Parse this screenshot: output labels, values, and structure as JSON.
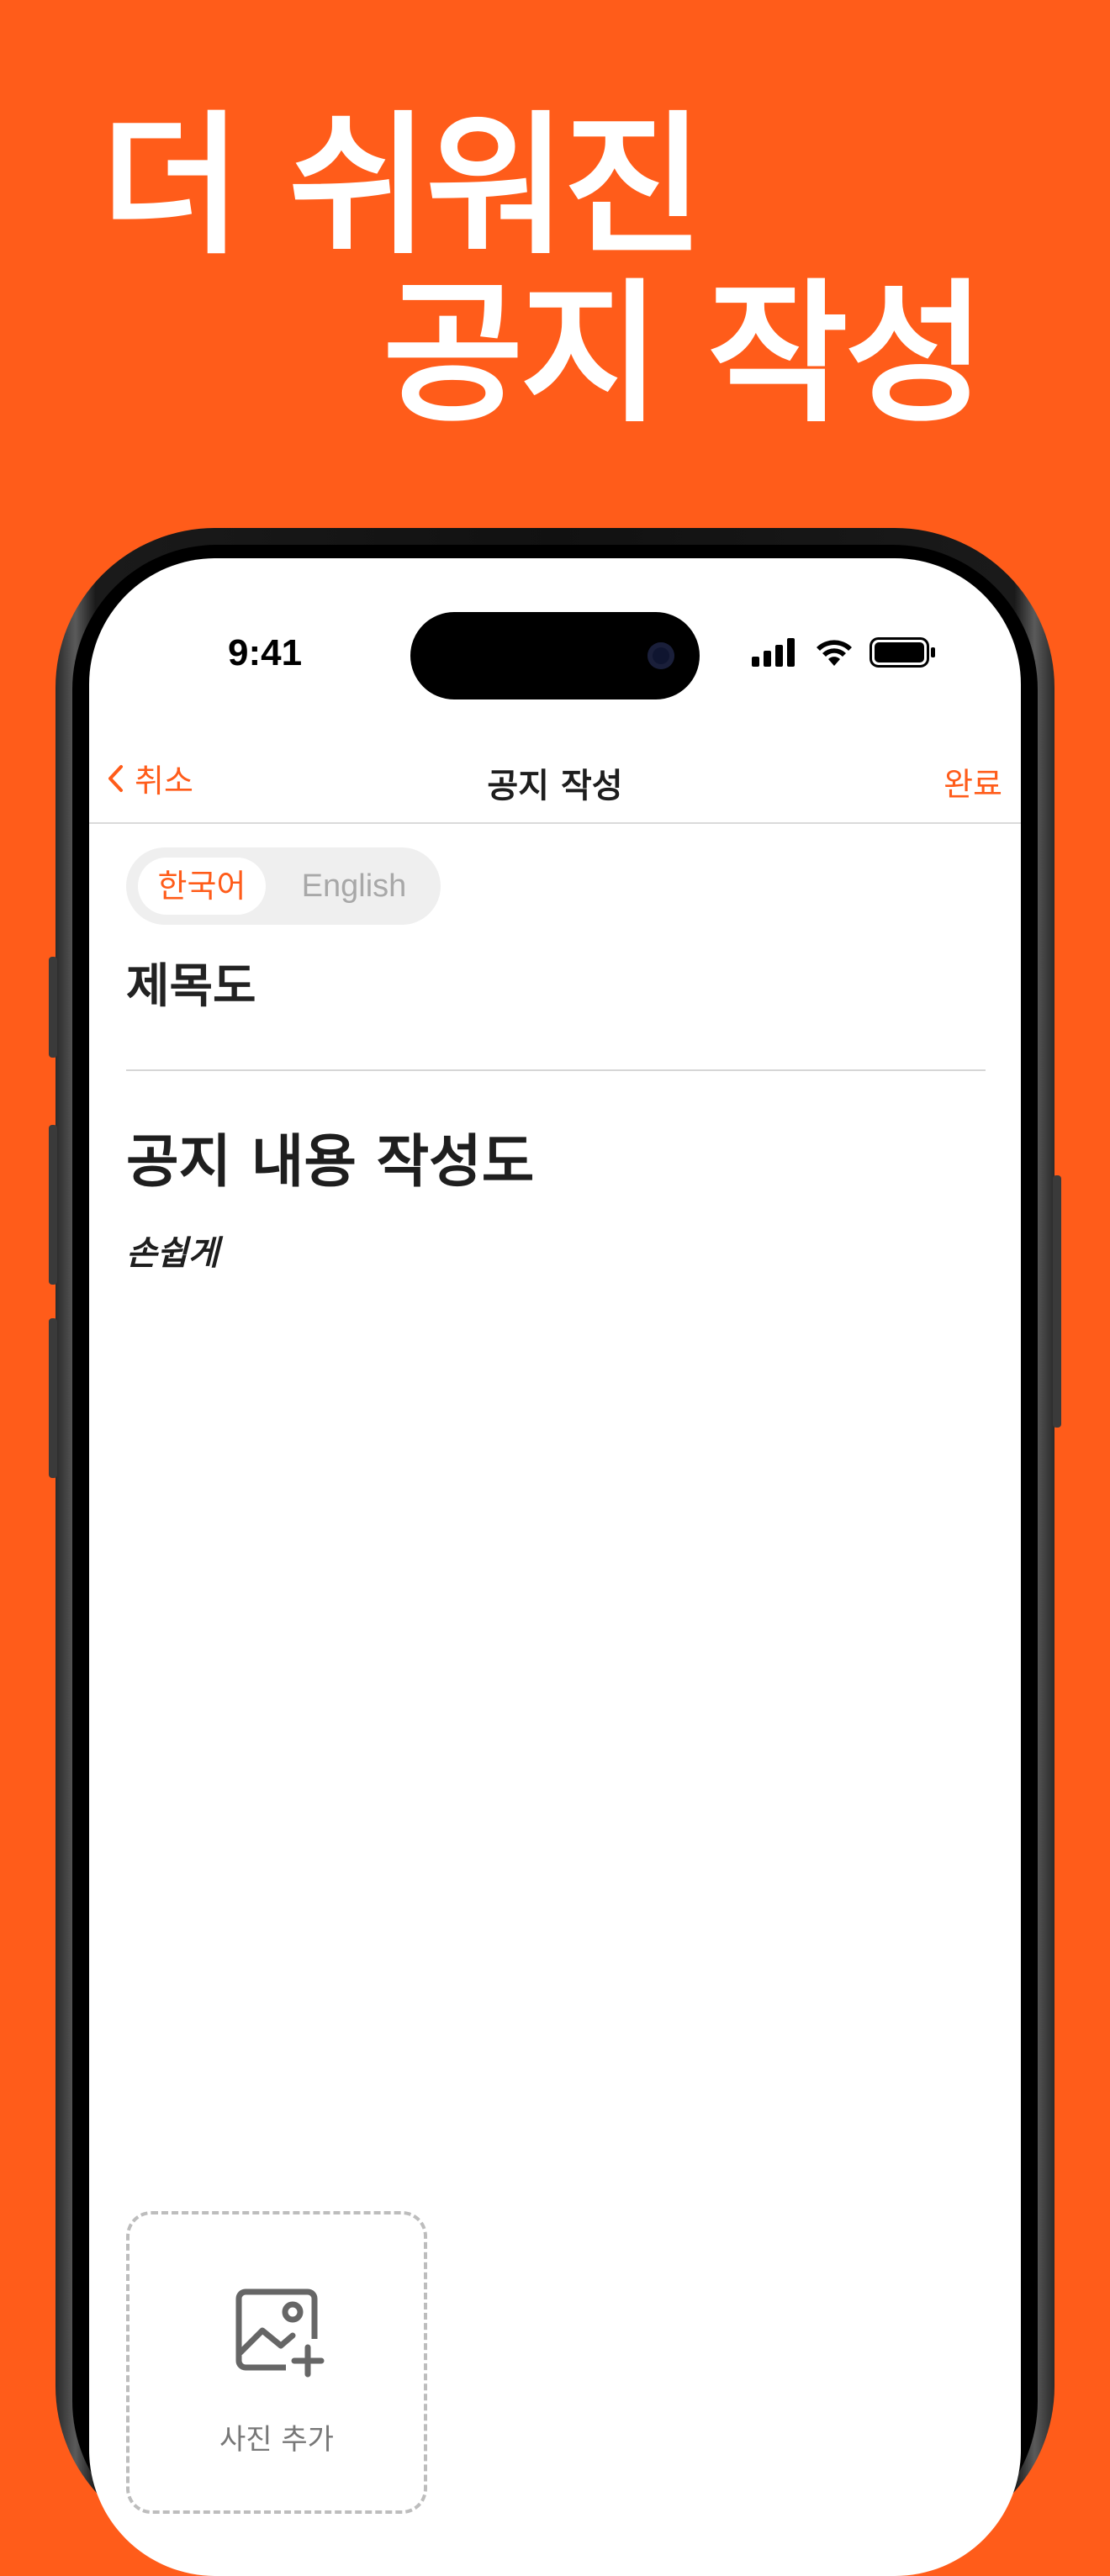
{
  "headline": {
    "line1": "더 쉬워진",
    "line2": "공지 작성"
  },
  "status_bar": {
    "time": "9:41"
  },
  "nav": {
    "back_label": "취소",
    "title": "공지 작성",
    "done_label": "완료"
  },
  "language_toggle": {
    "options": [
      "한국어",
      "English"
    ],
    "selected": "한국어"
  },
  "editor": {
    "title_value": "제목도",
    "content_heading": "공지 내용 작성도",
    "content_italic": "손쉽게"
  },
  "photo": {
    "add_label": "사진 추가"
  },
  "colors": {
    "background": "#FF5C1A",
    "accent": "#FF5C1A",
    "screen": "#FFFFFF"
  }
}
